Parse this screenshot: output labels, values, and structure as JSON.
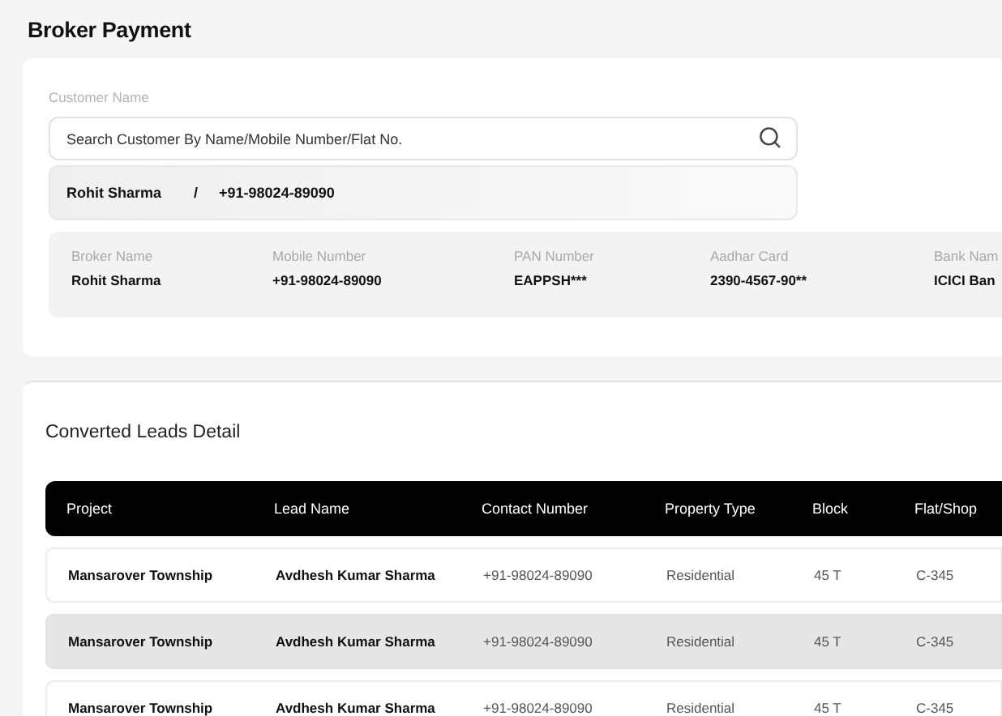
{
  "page": {
    "title": "Broker Payment"
  },
  "customer": {
    "label": "Customer Name",
    "search": {
      "placeholder": "Search Customer By Name/Mobile Number/Flat No."
    },
    "result": {
      "name": "Rohit Sharma",
      "separator": "/",
      "phone": "+91-98024-89090"
    }
  },
  "broker_details": [
    {
      "label": "Broker Name",
      "value": "Rohit Sharma"
    },
    {
      "label": "Mobile Number",
      "value": "+91-98024-89090"
    },
    {
      "label": "PAN Number",
      "value": "EAPPSH***"
    },
    {
      "label": "Aadhar Card",
      "value": "2390-4567-90**"
    },
    {
      "label": "Bank Nam",
      "value": "ICICI Ban"
    }
  ],
  "leads": {
    "title": "Converted Leads Detail",
    "columns": [
      "Project",
      "Lead Name",
      "Contact Number",
      "Property Type",
      "Block",
      "Flat/Shop"
    ],
    "rows": [
      {
        "selected": false,
        "cells": [
          "Mansarover Township",
          "Avdhesh Kumar Sharma",
          "+91-98024-89090",
          "Residential",
          "45 T",
          "C-345"
        ]
      },
      {
        "selected": true,
        "cells": [
          "Mansarover Township",
          "Avdhesh Kumar Sharma",
          "+91-98024-89090",
          "Residential",
          "45 T",
          "C-345"
        ]
      },
      {
        "selected": false,
        "cells": [
          "Mansarover Township",
          "Avdhesh Kumar Sharma",
          "+91-98024-89090",
          "Residential",
          "45 T",
          "C-345"
        ]
      }
    ]
  }
}
